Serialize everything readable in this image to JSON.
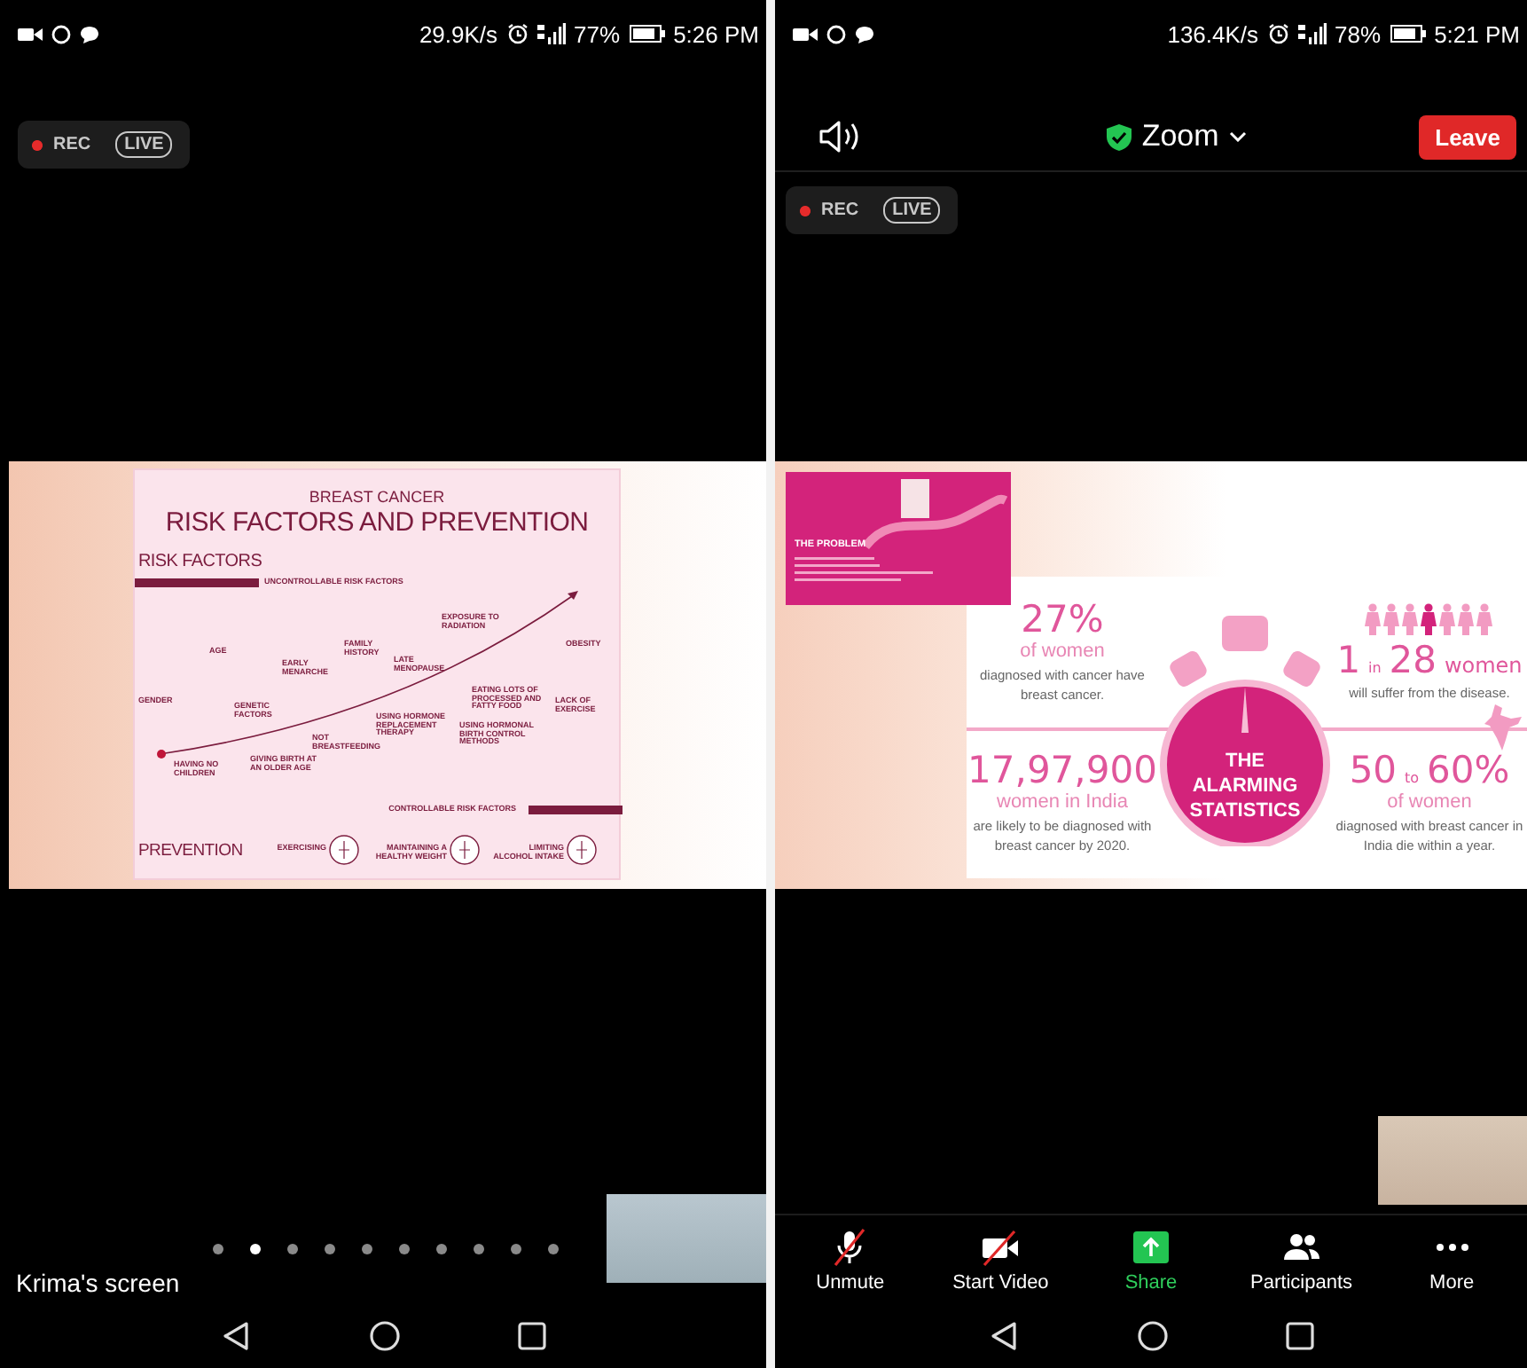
{
  "left_phone": {
    "status_bar": {
      "net_speed": "29.9K/s",
      "battery": "77%",
      "time": "5:26 PM"
    },
    "recording": {
      "rec": "REC",
      "live": "LIVE"
    },
    "shared_slide": {
      "title": "BREAST CANCER",
      "subtitle": "RISK FACTORS AND PREVENTION",
      "risk_heading": "RISK FACTORS",
      "uncontrollable": "UNCONTROLLABLE RISK FACTORS",
      "factors": [
        {
          "label": "AGE"
        },
        {
          "label": "GENDER"
        },
        {
          "label": "GENETIC FACTORS"
        },
        {
          "label": "EARLY MENARCHE"
        },
        {
          "label": "FAMILY HISTORY"
        },
        {
          "label": "LATE MENOPAUSE"
        },
        {
          "label": "EXPOSURE TO RADIATION"
        },
        {
          "label": "OBESITY"
        },
        {
          "label": "EATING LOTS OF PROCESSED AND FATTY FOOD"
        },
        {
          "label": "LACK OF EXERCISE"
        },
        {
          "label": "USING HORMONE REPLACEMENT THERAPY"
        },
        {
          "label": "USING HORMONAL BIRTH CONTROL METHODS"
        },
        {
          "label": "NOT BREASTFEEDING"
        },
        {
          "label": "HAVING NO CHILDREN"
        },
        {
          "label": "GIVING BIRTH AT AN OLDER AGE"
        }
      ],
      "controllable": "CONTROLLABLE RISK FACTORS",
      "prevention_heading": "PREVENTION",
      "prevention": [
        "EXERCISING",
        "MAINTAINING A HEALTHY WEIGHT",
        "LIMITING ALCOHOL INTAKE"
      ]
    },
    "page_dots": [
      {
        "selected": false
      },
      {
        "selected": true
      },
      {
        "selected": false
      },
      {
        "selected": false
      },
      {
        "selected": false
      },
      {
        "selected": false
      },
      {
        "selected": false
      },
      {
        "selected": false
      },
      {
        "selected": false
      },
      {
        "selected": false
      }
    ],
    "screen_label": "Krima's screen"
  },
  "right_phone": {
    "status_bar": {
      "net_speed": "136.4K/s",
      "battery": "78%",
      "time": "5:21 PM"
    },
    "meeting_bar": {
      "meeting_name": "Zoom",
      "leave": "Leave"
    },
    "recording": {
      "rec": "REC",
      "live": "LIVE"
    },
    "shared_slide": {
      "problem_title": "THE PROBLEM",
      "center_title": "THE ALARMING STATISTICS",
      "stats": [
        {
          "figure": [
            {
              "text": "27%",
              "kind": "big"
            }
          ],
          "unit": "of women",
          "text": "diagnosed with cancer have breast cancer."
        },
        {
          "figure": [
            {
              "text": "1",
              "kind": "big"
            },
            {
              "text": "in",
              "kind": "small"
            },
            {
              "text": "28",
              "kind": "big"
            },
            {
              "text": "women",
              "kind": "mid"
            }
          ],
          "text": "will suffer from the disease."
        },
        {
          "figure": [
            {
              "text": "17,97,900",
              "kind": "big"
            }
          ],
          "unit": "women in India",
          "text": "are likely to be diagnosed with breast cancer by 2020."
        },
        {
          "figure": [
            {
              "text": "50",
              "kind": "big"
            },
            {
              "text": "to",
              "kind": "small"
            },
            {
              "text": "60%",
              "kind": "big"
            }
          ],
          "unit": "of women",
          "text": "diagnosed with breast cancer in India die within a year."
        }
      ]
    },
    "toolbar": [
      {
        "kind": "mic",
        "label": "Unmute"
      },
      {
        "kind": "video",
        "label": "Start Video"
      },
      {
        "kind": "share",
        "label": "Share"
      },
      {
        "kind": "participants",
        "label": "Participants"
      },
      {
        "kind": "more",
        "label": "More"
      }
    ]
  }
}
